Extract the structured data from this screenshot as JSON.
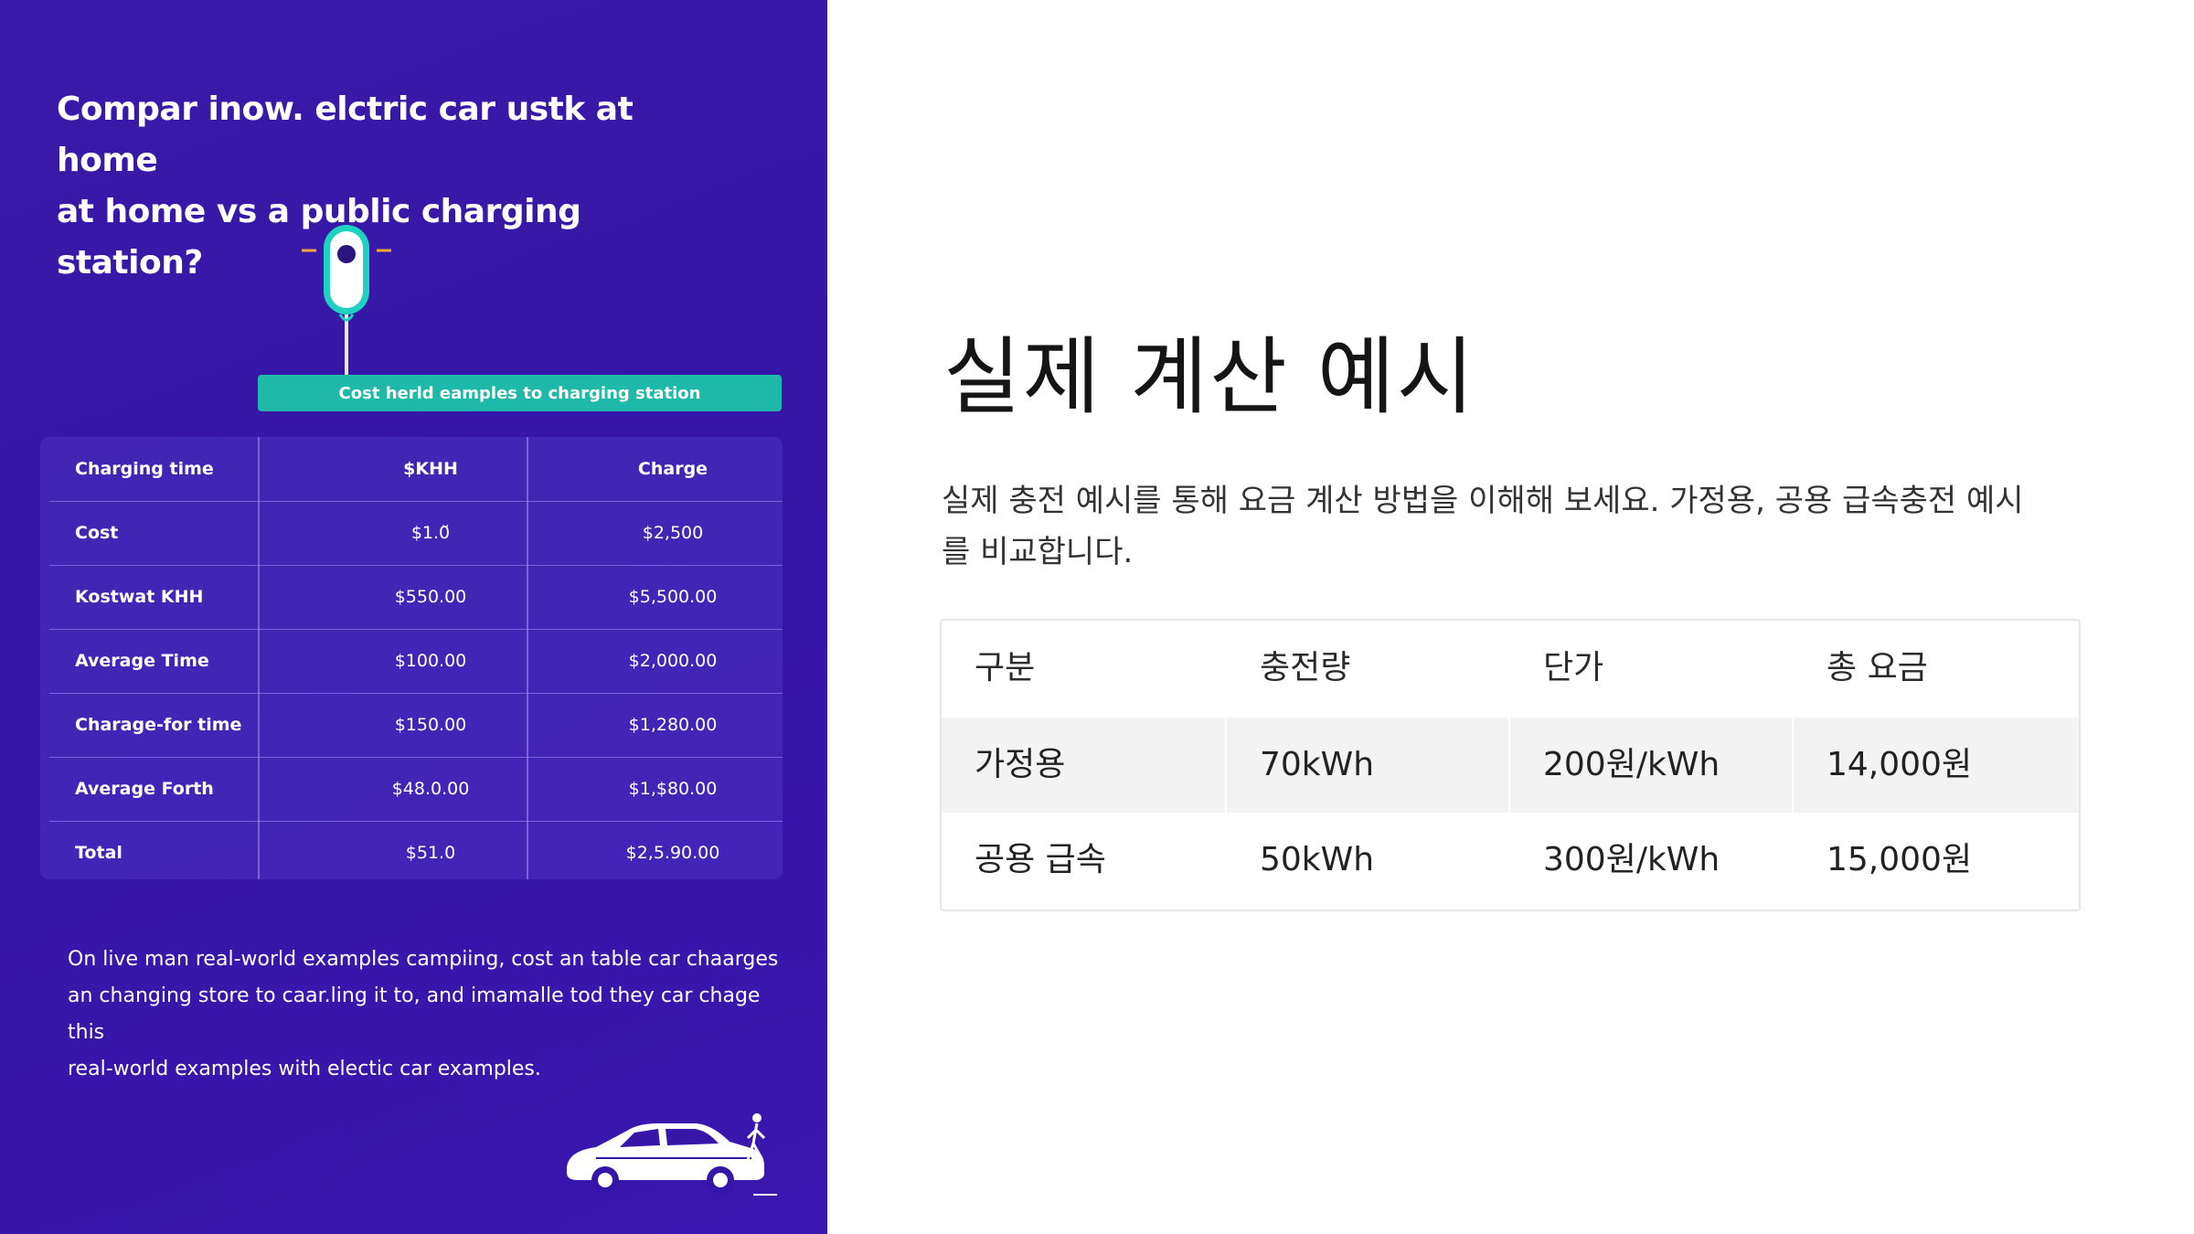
{
  "infographic": {
    "title_line1": "Compar inow. elctric car ustk at home",
    "title_line2": "at home vs a public charging station?",
    "banner": "Cost herld eamples to charging station",
    "table_headers": [
      "Charging time",
      "$KHH",
      "Charge"
    ],
    "table_rows": [
      [
        "Cost",
        "$1.0̆",
        "$2,500"
      ],
      [
        "Kostwat KHH",
        "$550.00",
        "$5,500.00"
      ],
      [
        "Average Time",
        "$100.00",
        "$2,000.00"
      ],
      [
        "Charage-for time",
        "$150.00",
        "$1,280.00"
      ],
      [
        "Average Forth",
        "$48.0.00",
        "$1,$80.00"
      ],
      [
        "Total",
        "$51.0",
        "$2,5.90.00"
      ]
    ],
    "description_line1": "On live man real-world examples campiing, cost an table car chaarges",
    "description_line2": "an changing store to caar.ling it to, and imamalle tod they car chage this",
    "description_line3": "real-world examples with electic car examples.",
    "colors": {
      "background": "#3516a6",
      "banner": "#1fb9aa",
      "text": "#ffffff"
    },
    "icons": [
      "ev-charger-icon",
      "car-icon",
      "person-icon"
    ]
  },
  "slide": {
    "title": "실제 계산 예시",
    "description_line1": "실제 충전 예시를 통해 요금 계산 방법을 이해해 보세요. 가정용, 공용 급속충전 예시",
    "description_line2": "를 비교합니다.",
    "table": {
      "headers": [
        "구분",
        "충전량",
        "단가",
        "총 요금"
      ],
      "rows": [
        [
          "가정용",
          "70kWh",
          "200원/kWh",
          "14,000원"
        ],
        [
          "공용 급속",
          "50kWh",
          "300원/kWh",
          "15,000원"
        ]
      ]
    }
  }
}
